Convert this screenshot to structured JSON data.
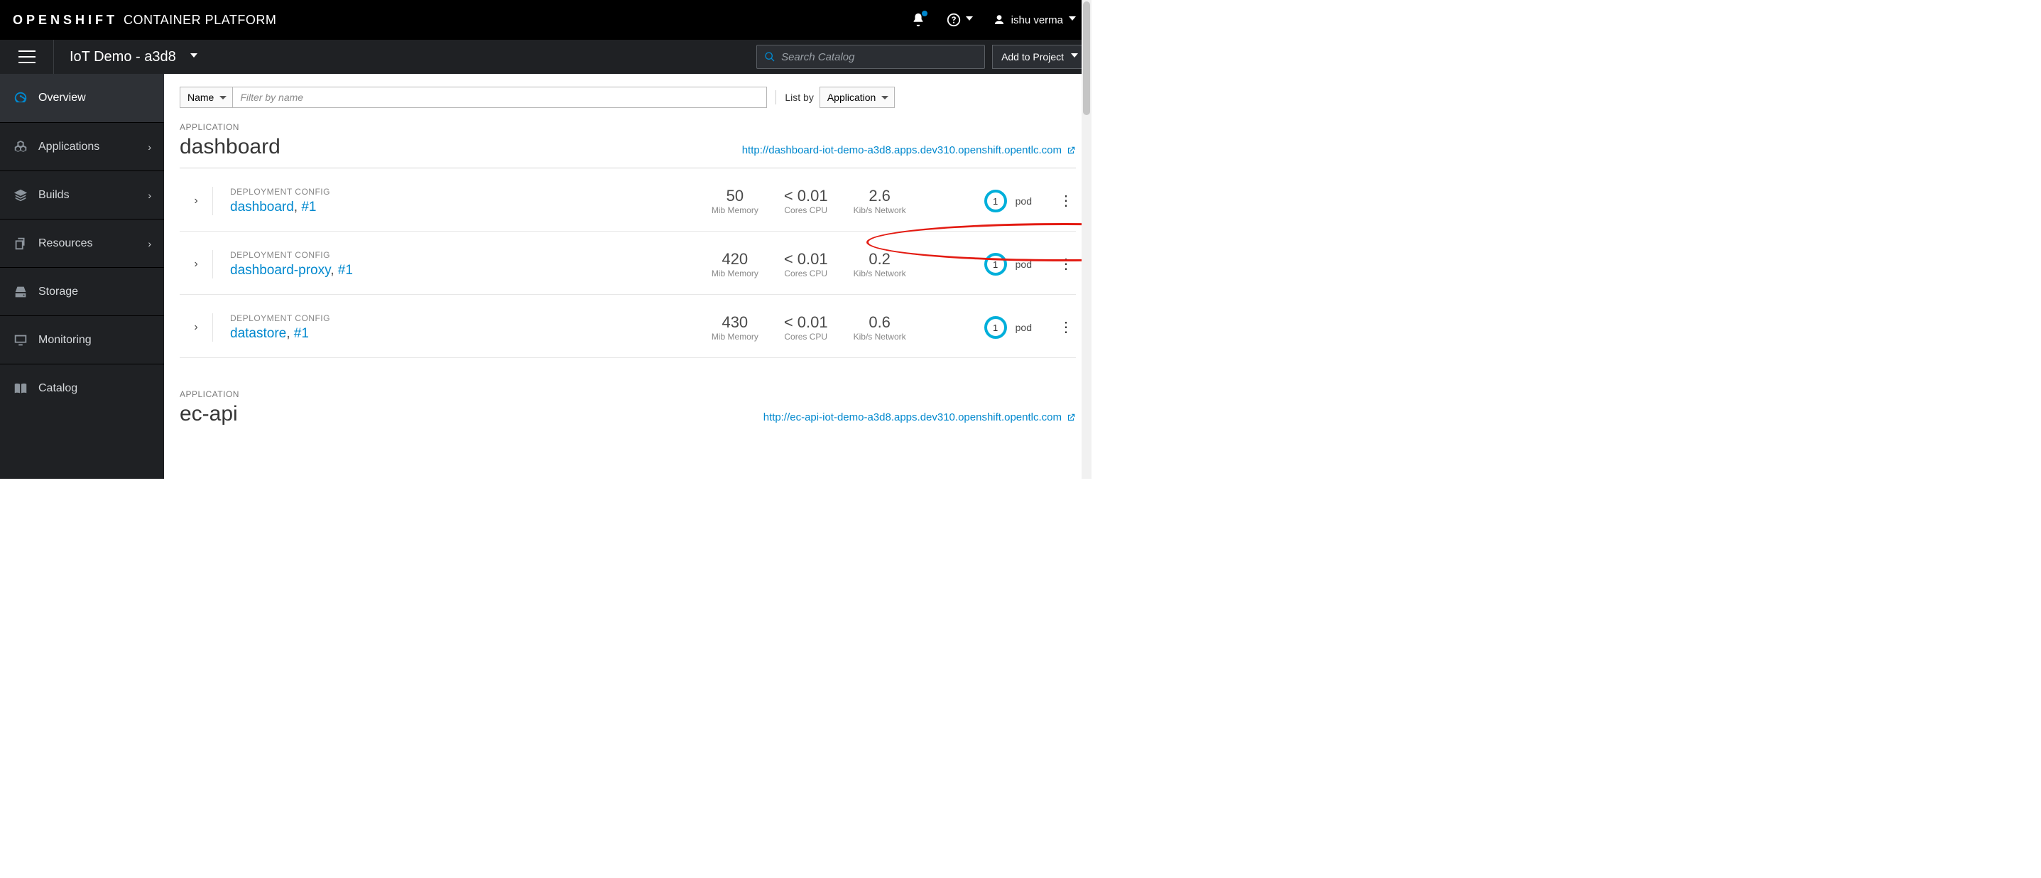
{
  "brand": {
    "strong": "OPENSHIFT",
    "light": "CONTAINER PLATFORM"
  },
  "user_name": "ishu verma",
  "project_name": "IoT Demo - a3d8",
  "search_placeholder": "Search Catalog",
  "add_to_project": "Add to Project",
  "sidebar": {
    "items": [
      {
        "label": "Overview"
      },
      {
        "label": "Applications"
      },
      {
        "label": "Builds"
      },
      {
        "label": "Resources"
      },
      {
        "label": "Storage"
      },
      {
        "label": "Monitoring"
      },
      {
        "label": "Catalog"
      }
    ]
  },
  "filters": {
    "filter_dropdown": "Name",
    "filter_placeholder": "Filter by name",
    "listby_label": "List by",
    "listby_value": "Application"
  },
  "caption_app": "APPLICATION",
  "caption_dc": "DEPLOYMENT CONFIG",
  "metrics_labels": {
    "mem": "Mib Memory",
    "cpu": "Cores CPU",
    "net": "Kib/s Network"
  },
  "pod_label": "pod",
  "applications": [
    {
      "name": "dashboard",
      "url": "http://dashboard-iot-demo-a3d8.apps.dev310.openshift.opentlc.com",
      "dcs": [
        {
          "name": "dashboard",
          "build": "#1",
          "mem": "50",
          "cpu": "< 0.01",
          "net": "2.6",
          "pods": "1"
        },
        {
          "name": "dashboard-proxy",
          "build": "#1",
          "mem": "420",
          "cpu": "< 0.01",
          "net": "0.2",
          "pods": "1"
        },
        {
          "name": "datastore",
          "build": "#1",
          "mem": "430",
          "cpu": "< 0.01",
          "net": "0.6",
          "pods": "1"
        }
      ]
    },
    {
      "name": "ec-api",
      "url": "http://ec-api-iot-demo-a3d8.apps.dev310.openshift.opentlc.com",
      "dcs": []
    }
  ]
}
